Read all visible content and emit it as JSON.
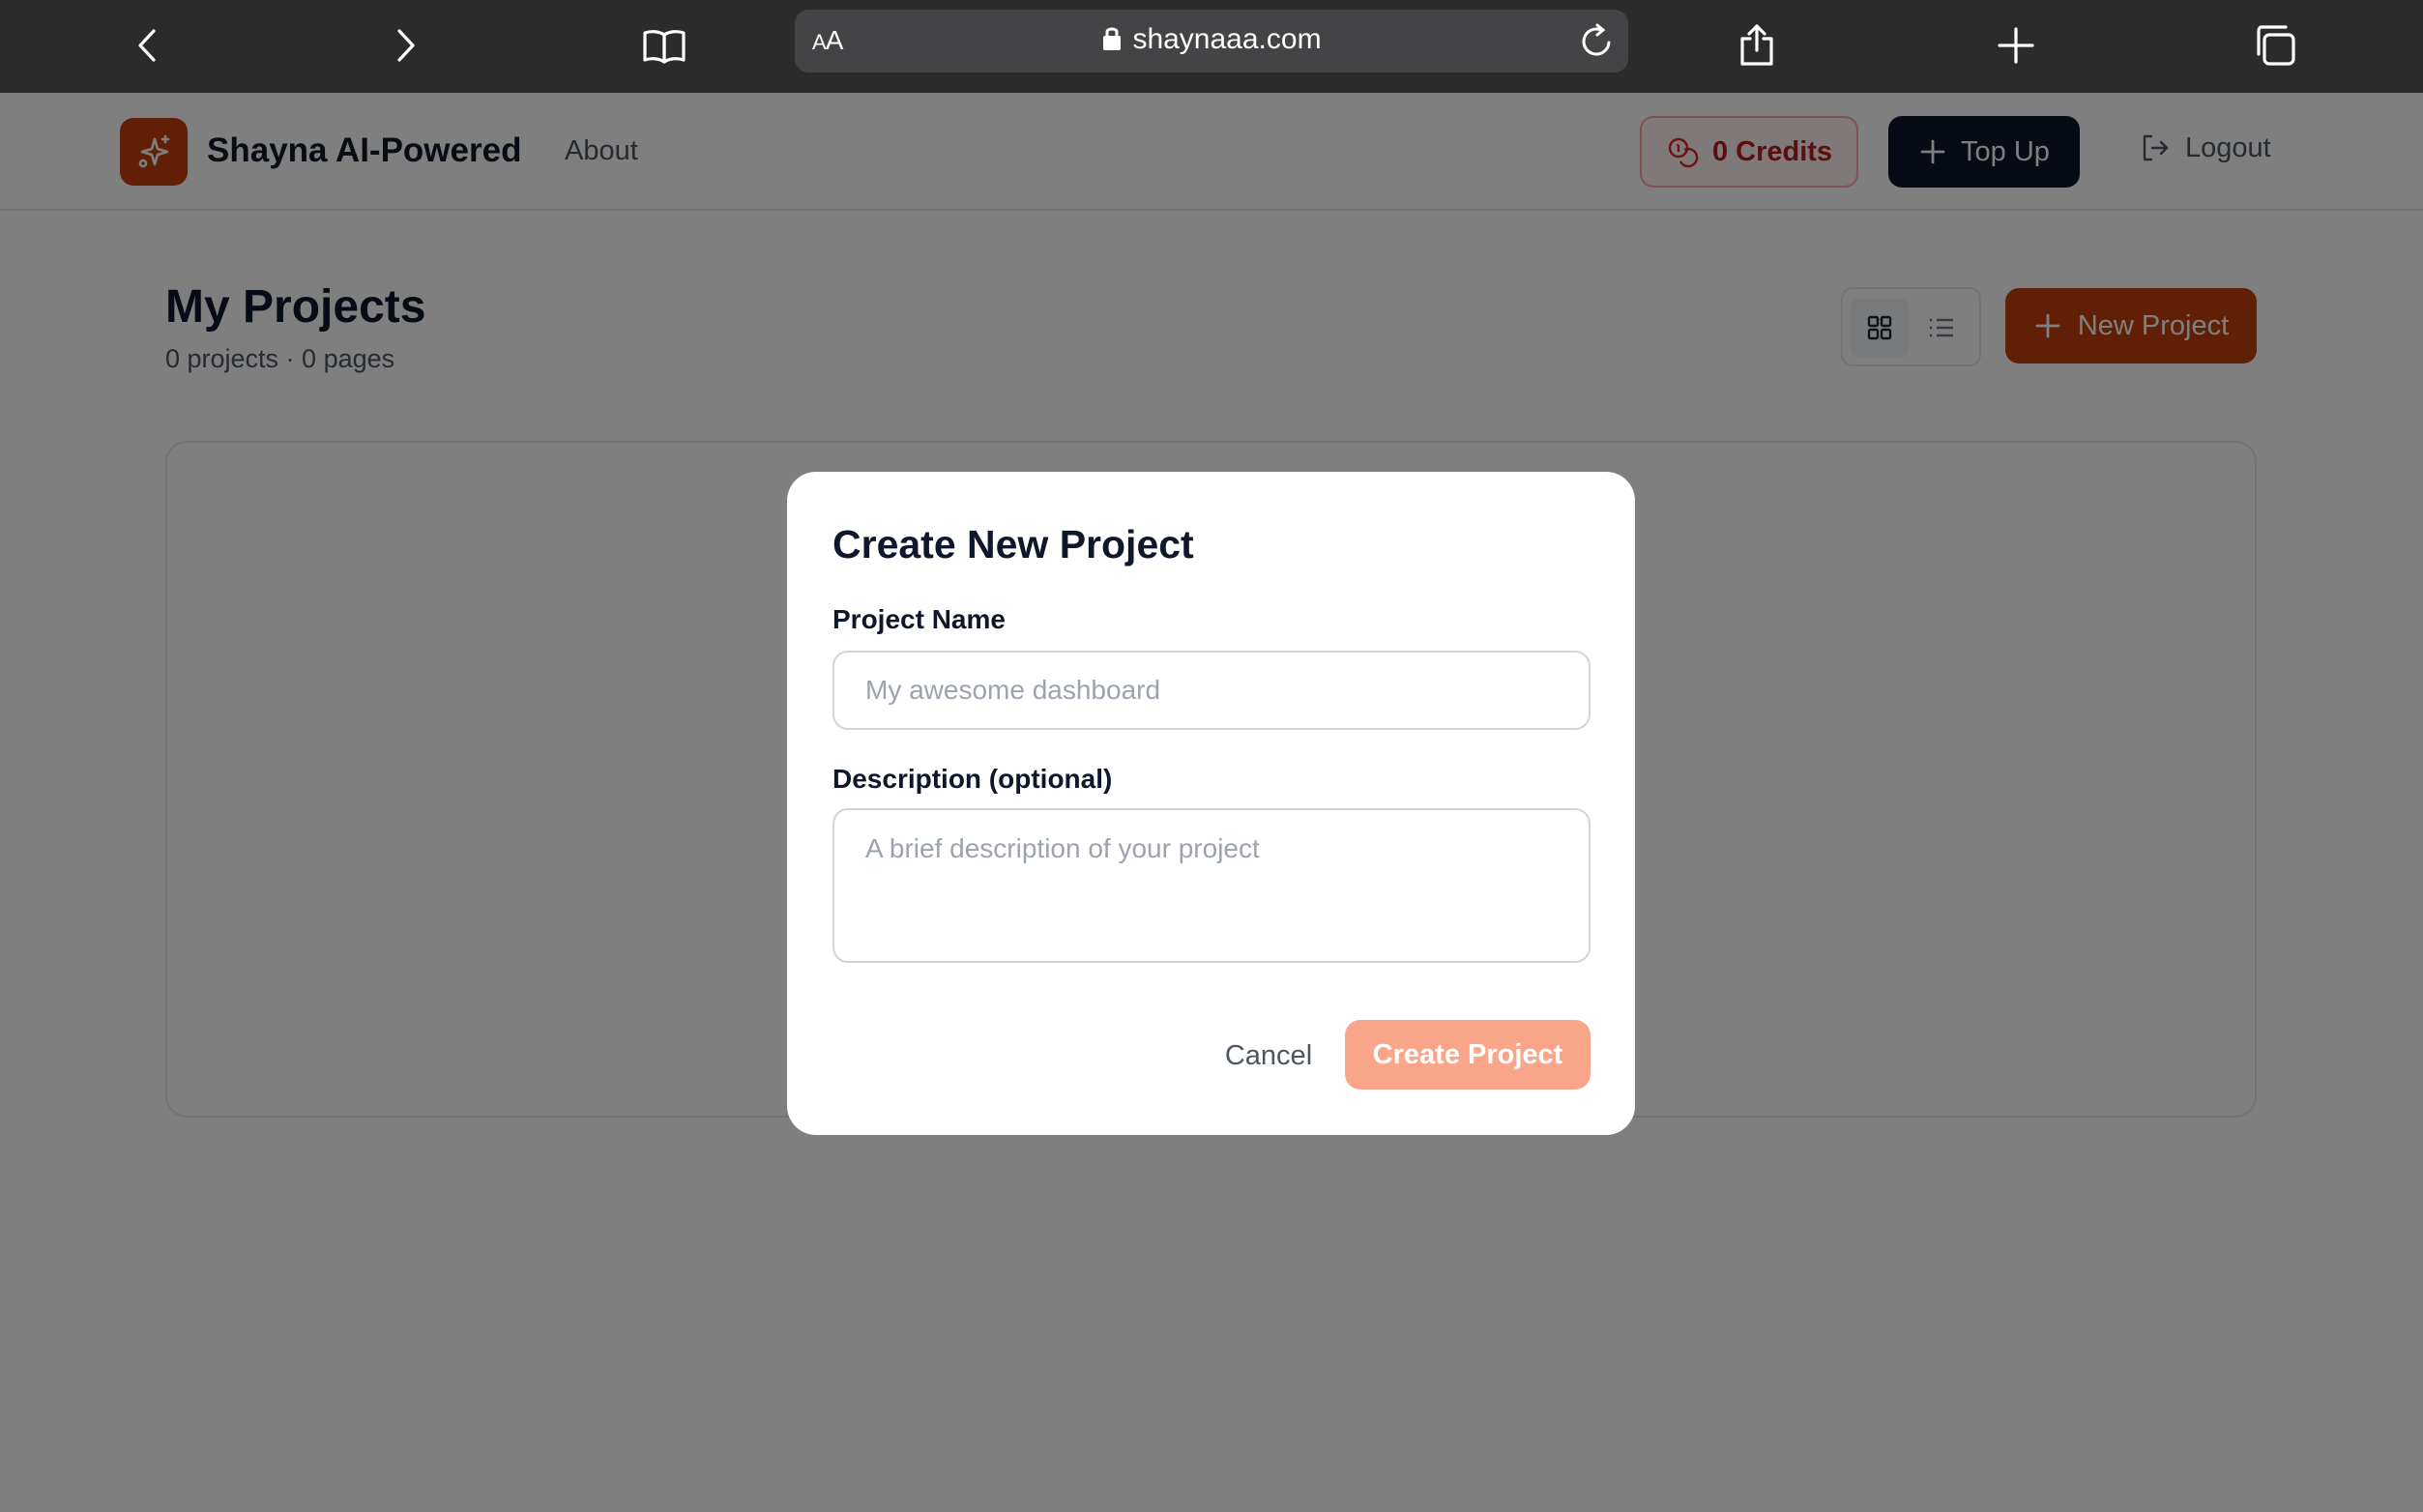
{
  "browser": {
    "url_text_size": "AA",
    "url": "shaynaaa.com",
    "icons": [
      "back-arrow-icon",
      "forward-arrow-icon",
      "book-icon",
      "lock-icon",
      "reload-icon",
      "share-icon",
      "plus-icon",
      "tabs-icon"
    ]
  },
  "header": {
    "brand": "Shayna AI-Powered",
    "nav": {
      "about": "About"
    },
    "credits_label": "0 Credits",
    "topup_label": "Top Up",
    "logout_label": "Logout",
    "colors": {
      "brand": "#c2410c",
      "topup": "#0f172a",
      "credits_text": "#b91c1c"
    }
  },
  "page": {
    "title": "My Projects",
    "subtitle": "0 projects · 0 pages",
    "new_project_label": "New Project",
    "view_modes": [
      "grid",
      "list"
    ],
    "selected_view": "grid"
  },
  "modal": {
    "title": "Create New Project",
    "name_label": "Project Name",
    "name_value": "",
    "name_placeholder": "My awesome dashboard",
    "desc_label": "Description (optional)",
    "desc_value": "",
    "desc_placeholder": "A brief description of your project",
    "cancel_label": "Cancel",
    "create_label": "Create Project",
    "colors": {
      "create_button": "#f9a58a"
    }
  }
}
